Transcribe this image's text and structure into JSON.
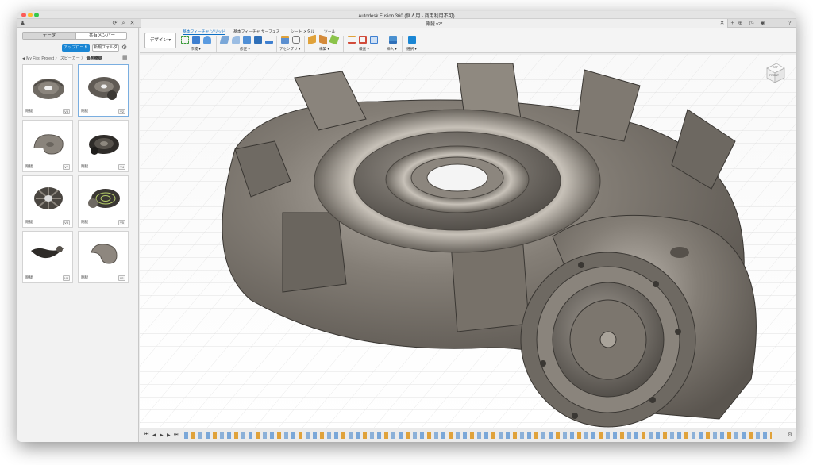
{
  "window": {
    "title": "Autodesk Fusion 360 (個人用 - 商用利用不可)",
    "document_tab": "剛腿 v2*"
  },
  "left_panel": {
    "segments": [
      "データ",
      "共有メンバー"
    ],
    "upload_label": "アップロード",
    "new_folder_label": "新規フォルダ",
    "breadcrumb": [
      "My First Project",
      "スピーカー",
      "渦巻腰腿"
    ],
    "thumbnails": [
      {
        "name": "剛腿",
        "version": "V3"
      },
      {
        "name": "剛腿",
        "version": "V2"
      },
      {
        "name": "剛腿",
        "version": "V7"
      },
      {
        "name": "剛腿",
        "version": "V4"
      },
      {
        "name": "剛腿",
        "version": "V3"
      },
      {
        "name": "剛腿",
        "version": "V5"
      },
      {
        "name": "剛腿",
        "version": "V3"
      },
      {
        "name": "剛腿",
        "version": "V1"
      }
    ]
  },
  "toolbar": {
    "workspace": "デザイン ▾",
    "tabs": [
      "基本フィーチャ ソリッド",
      "基本フィーチャ サーフェス",
      "シート メタル",
      "ツール"
    ],
    "groups": [
      "作成 ▾",
      "修正 ▾",
      "アセンブリ ▾",
      "構築 ▾",
      "検査 ▾",
      "挿入 ▾",
      "選択 ▾"
    ]
  },
  "view": {
    "viewcube_labels": [
      "TOP",
      "FRONT"
    ]
  },
  "colors": {
    "accent": "#1a86d4",
    "model": "#7a746c"
  }
}
